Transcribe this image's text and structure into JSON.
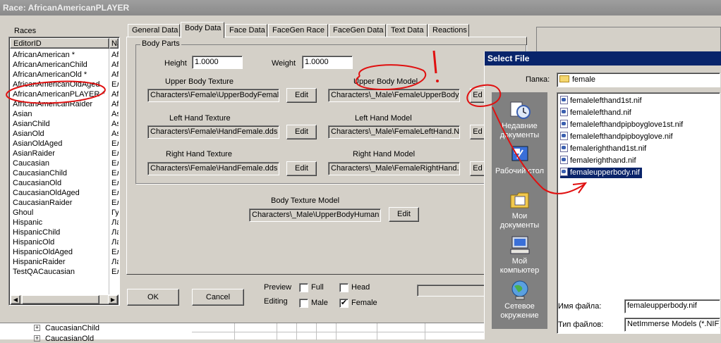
{
  "window": {
    "title": "Race: AfricanAmericanPLAYER"
  },
  "races": {
    "label": "Races",
    "columns": [
      "EditorID",
      "Na"
    ],
    "rows": [
      {
        "id": "AfricanAmerican *",
        "n": "Af"
      },
      {
        "id": "AfricanAmericanChild",
        "n": "Af"
      },
      {
        "id": "AfricanAmericanOld *",
        "n": "Af"
      },
      {
        "id": "AfricanAmericanOldAged",
        "n": "Ел"
      },
      {
        "id": "AfricanAmericanPLAYER *",
        "n": "Af"
      },
      {
        "id": "AfricanAmericanRaider",
        "n": "Af"
      },
      {
        "id": "Asian",
        "n": "As"
      },
      {
        "id": "AsianChild",
        "n": "As"
      },
      {
        "id": "AsianOld",
        "n": "As"
      },
      {
        "id": "AsianOldAged",
        "n": "Ел"
      },
      {
        "id": "AsianRaider",
        "n": "Ел"
      },
      {
        "id": "Caucasian",
        "n": "Ел"
      },
      {
        "id": "CaucasianChild",
        "n": "Ел"
      },
      {
        "id": "CaucasianOld",
        "n": "Ел"
      },
      {
        "id": "CaucasianOldAged",
        "n": "Ел"
      },
      {
        "id": "CaucasianRaider",
        "n": "Ел"
      },
      {
        "id": "Ghoul",
        "n": "Гу"
      },
      {
        "id": "Hispanic",
        "n": "Ла"
      },
      {
        "id": "HispanicChild",
        "n": "Ла"
      },
      {
        "id": "HispanicOld",
        "n": "Ла"
      },
      {
        "id": "HispanicOldAged",
        "n": "Ел"
      },
      {
        "id": "HispanicRaider",
        "n": "Ла"
      },
      {
        "id": "TestQACaucasian",
        "n": "Ел"
      }
    ]
  },
  "tabs": [
    "General Data",
    "Body Data",
    "Face Data",
    "FaceGen Race",
    "FaceGen Data",
    "Text Data",
    "Reactions"
  ],
  "active_tab": "Body Data",
  "body_parts": {
    "group_title": "Body Parts",
    "height_label": "Height",
    "height_value": "1.0000",
    "weight_label": "Weight",
    "weight_value": "1.0000",
    "upper_body_texture_label": "Upper Body Texture",
    "upper_body_texture_value": "Characters\\Female\\UpperBodyFemal",
    "upper_body_model_label": "Upper Body Model",
    "upper_body_model_value": "Characters\\_Male\\FemaleUpperBody.",
    "left_hand_texture_label": "Left Hand Texture",
    "left_hand_texture_value": "Characters\\Female\\HandFemale.dds",
    "left_hand_model_label": "Left Hand Model",
    "left_hand_model_value": "Characters\\_Male\\FemaleLeftHand.NI",
    "right_hand_texture_label": "Right Hand Texture",
    "right_hand_texture_value": "Characters\\Female\\HandFemale.dds",
    "right_hand_model_label": "Right Hand Model",
    "right_hand_model_value": "Characters\\_Male\\FemaleRightHand.",
    "edit_label": "Edit",
    "edit_cut_label": "Ed"
  },
  "body_texture_model": {
    "label": "Body Texture Model",
    "value": "Characters\\_Male\\UpperBodyHuman",
    "edit_label": "Edit"
  },
  "bottom": {
    "ok_label": "OK",
    "cancel_label": "Cancel",
    "preview_label": "Preview",
    "editing_label": "Editing",
    "full_label": "Full",
    "head_label": "Head",
    "male_label": "Male",
    "female_label": "Female",
    "full_checked": false,
    "head_checked": false,
    "male_checked": false,
    "female_checked": true
  },
  "tree": {
    "item1": "CaucasianChild",
    "item2": "CaucasianOld"
  },
  "annotation": {
    "exclamation": "!"
  },
  "select_file": {
    "title": "Select File",
    "folder_label": "Папка:",
    "folder_value": "female",
    "places": [
      "Недавние документы",
      "Рабочий стол",
      "Мои документы",
      "Мой компьютер",
      "Сетевое окружение"
    ],
    "files": [
      "femalelefthand1st.nif",
      "femalelefthand.nif",
      "femalelefthandpipboyglove1st.nif",
      "femalelefthandpipboyglove.nif",
      "femalerighthand1st.nif",
      "femalerighthand.nif",
      "femaleupperbody.nif"
    ],
    "selected_file": "femaleupperbody.nif",
    "filename_label": "Имя файла:",
    "filename_value": "femaleupperbody.nif",
    "filetype_label": "Тип файлов:",
    "filetype_value": "NetImmerse Models (*.NIF)"
  },
  "colors": {
    "accent_selection": "#0a246a",
    "annotation_red": "#e01010",
    "window_face": "#d4d0c8"
  }
}
